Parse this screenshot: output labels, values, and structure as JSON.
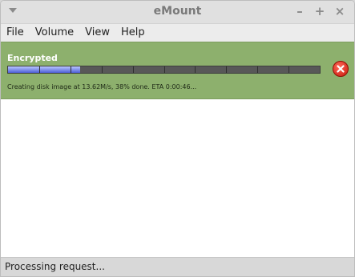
{
  "window": {
    "title": "eMount"
  },
  "menu": {
    "items": [
      "File",
      "Volume",
      "View",
      "Help"
    ]
  },
  "operation": {
    "name": "Encrypted",
    "progress_percent": 38,
    "segments": 10,
    "status": "Creating disk image at 13.62M/s, 38% done. ETA 0:00:46...",
    "colors": {
      "panel": "#8db06d",
      "fill": "#4d5fd8"
    }
  },
  "statusbar": {
    "text": "Processing request..."
  }
}
